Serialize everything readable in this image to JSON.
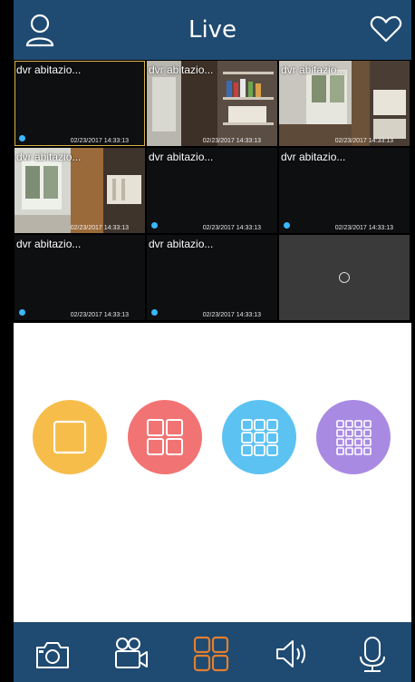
{
  "header": {
    "title": "Live",
    "left_icon": "person-icon",
    "right_icon": "heart-icon"
  },
  "tiles": [
    {
      "name": "dvr abitazio...",
      "timestamp": "02/23/2017 14:33:13"
    },
    {
      "name": "dvr abitazio...",
      "timestamp": "02/23/2017 14:33:13"
    },
    {
      "name": "dvr abitazio...",
      "timestamp": "02/23/2017 14:33:13"
    },
    {
      "name": "dvr abitazio...",
      "timestamp": "02/23/2017 14:33:13"
    },
    {
      "name": "dvr abitazio...",
      "timestamp": "02/23/2017 14:33:13"
    },
    {
      "name": "dvr abitazio...",
      "timestamp": "02/23/2017 14:33:13"
    },
    {
      "name": "dvr abitazio...",
      "timestamp": "02/23/2017 14:33:13"
    },
    {
      "name": "dvr abitazio...",
      "timestamp": "02/23/2017 14:33:13"
    }
  ],
  "layout_buttons": [
    {
      "name": "single-view",
      "color": "#f6bd4a"
    },
    {
      "name": "four-view",
      "color": "#f27373"
    },
    {
      "name": "nine-view",
      "color": "#5cc2f2"
    },
    {
      "name": "sixteen-view",
      "color": "#a98ae3"
    }
  ],
  "bottom_bar": [
    {
      "name": "snapshot",
      "icon": "camera-icon"
    },
    {
      "name": "record",
      "icon": "video-camera-icon"
    },
    {
      "name": "layout",
      "icon": "grid-icon",
      "active_color": "#e3802f"
    },
    {
      "name": "audio",
      "icon": "speaker-icon"
    },
    {
      "name": "talk",
      "icon": "microphone-icon"
    }
  ],
  "colors": {
    "header_bg": "#1f4a72",
    "bottom_bg": "#1f4a72",
    "content_bg": "#ffffff",
    "selected_border": "#d8b24a",
    "status_dot": "#39b7ff"
  }
}
